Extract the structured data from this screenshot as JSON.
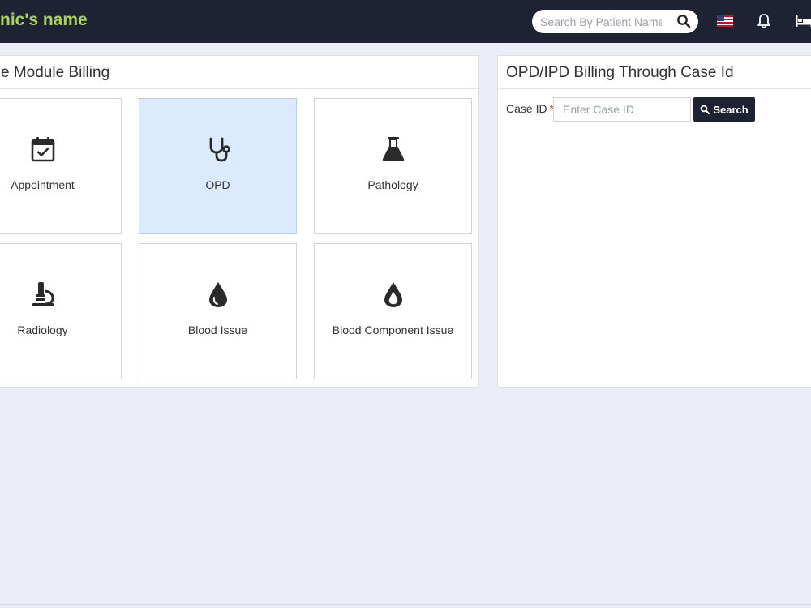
{
  "header": {
    "brand": "nic's name",
    "search_placeholder": "Search By Patient Name",
    "search_icon": "search-icon",
    "flag_icon": "us-flag-icon",
    "bell_icon": "bell-icon",
    "bed_icon": "bed-icon"
  },
  "billing_panel": {
    "title": "e Module Billing",
    "tiles": [
      {
        "label": "Appointment",
        "icon": "calendar-check-icon",
        "active": false
      },
      {
        "label": "OPD",
        "icon": "stethoscope-icon",
        "active": true
      },
      {
        "label": "Pathology",
        "icon": "flask-icon",
        "active": false
      },
      {
        "label": "Radiology",
        "icon": "microscope-icon",
        "active": false
      },
      {
        "label": "Blood Issue",
        "icon": "blood-drop-icon",
        "active": false
      },
      {
        "label": "Blood Component Issue",
        "icon": "blood-drop-outline-icon",
        "active": false
      }
    ]
  },
  "case_panel": {
    "title": "OPD/IPD Billing Through Case Id",
    "case_id_label": "Case ID",
    "required_mark": "*",
    "case_id_placeholder": "Enter Case ID",
    "case_id_value": "",
    "search_label": "Search"
  },
  "colors": {
    "topbar": "#1e2334",
    "brand": "#a4d65e",
    "active_tile": "#dbeafc",
    "background": "#ebeef6"
  }
}
